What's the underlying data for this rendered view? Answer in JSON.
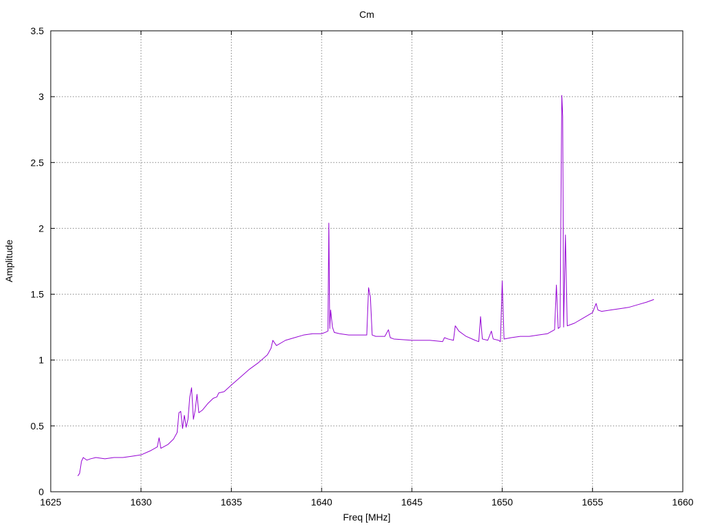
{
  "chart_data": {
    "type": "line",
    "title": "Cm",
    "xlabel": "Freq [MHz]",
    "ylabel": "Amplitude",
    "xlim": [
      1625,
      1660
    ],
    "ylim": [
      0,
      3.5
    ],
    "xticks": [
      1625,
      1630,
      1635,
      1640,
      1645,
      1650,
      1655,
      1660
    ],
    "yticks": [
      0,
      0.5,
      1,
      1.5,
      2,
      2.5,
      3,
      3.5
    ],
    "xtick_labels": [
      "1625",
      "1630",
      "1635",
      "1640",
      "1645",
      "1650",
      "1655",
      "1660"
    ],
    "ytick_labels": [
      "0",
      "0.5",
      "1",
      "1.5",
      "2",
      "2.5",
      "3",
      "3.5"
    ],
    "grid": true,
    "line_color": "#9400d3",
    "series": [
      {
        "x": [
          1626.5,
          1626.6,
          1626.7,
          1626.8,
          1627.0,
          1627.2,
          1627.5,
          1628.0,
          1628.5,
          1629.0,
          1629.5,
          1630.0,
          1630.5,
          1630.9,
          1631.0,
          1631.1,
          1631.5,
          1631.8,
          1632.0,
          1632.1,
          1632.2,
          1632.3,
          1632.4,
          1632.5,
          1632.6,
          1632.7,
          1632.8,
          1632.9,
          1633.0,
          1633.1,
          1633.2,
          1633.4,
          1633.7,
          1634.0,
          1634.2,
          1634.3,
          1634.6,
          1635.0,
          1635.5,
          1636.0,
          1636.5,
          1637.0,
          1637.2,
          1637.3,
          1637.5,
          1638.0,
          1638.5,
          1639.0,
          1639.5,
          1640.0,
          1640.2,
          1640.35,
          1640.4,
          1640.45,
          1640.5,
          1640.6,
          1640.7,
          1641.0,
          1641.5,
          1642.0,
          1642.5,
          1642.6,
          1642.7,
          1642.8,
          1643.0,
          1643.5,
          1643.7,
          1643.8,
          1644.0,
          1645.0,
          1646.0,
          1646.7,
          1646.8,
          1647.0,
          1647.3,
          1647.4,
          1647.6,
          1648.0,
          1648.5,
          1648.7,
          1648.8,
          1648.9,
          1649.2,
          1649.4,
          1649.5,
          1649.8,
          1649.9,
          1650.0,
          1650.1,
          1650.5,
          1651.0,
          1651.5,
          1652.0,
          1652.5,
          1652.9,
          1653.0,
          1653.1,
          1653.2,
          1653.3,
          1653.35,
          1653.4,
          1653.5,
          1653.6,
          1654.0,
          1654.5,
          1655.0,
          1655.2,
          1655.3,
          1655.5,
          1656.0,
          1656.5,
          1657.0,
          1657.5,
          1658.0,
          1658.4
        ],
        "y": [
          0.12,
          0.14,
          0.23,
          0.26,
          0.24,
          0.25,
          0.26,
          0.25,
          0.26,
          0.26,
          0.27,
          0.28,
          0.31,
          0.34,
          0.41,
          0.33,
          0.36,
          0.4,
          0.45,
          0.6,
          0.61,
          0.48,
          0.58,
          0.49,
          0.55,
          0.72,
          0.79,
          0.55,
          0.62,
          0.74,
          0.6,
          0.62,
          0.67,
          0.71,
          0.72,
          0.75,
          0.76,
          0.81,
          0.87,
          0.93,
          0.98,
          1.04,
          1.09,
          1.15,
          1.11,
          1.15,
          1.17,
          1.19,
          1.2,
          1.2,
          1.21,
          1.22,
          2.04,
          1.24,
          1.38,
          1.25,
          1.21,
          1.2,
          1.19,
          1.19,
          1.19,
          1.55,
          1.48,
          1.19,
          1.18,
          1.18,
          1.23,
          1.17,
          1.16,
          1.15,
          1.15,
          1.14,
          1.17,
          1.16,
          1.15,
          1.26,
          1.22,
          1.18,
          1.15,
          1.14,
          1.33,
          1.16,
          1.15,
          1.22,
          1.16,
          1.15,
          1.14,
          1.6,
          1.16,
          1.17,
          1.18,
          1.18,
          1.19,
          1.2,
          1.23,
          1.57,
          1.24,
          1.25,
          3.01,
          2.85,
          1.25,
          1.95,
          1.26,
          1.28,
          1.32,
          1.36,
          1.43,
          1.38,
          1.37,
          1.38,
          1.39,
          1.4,
          1.42,
          1.44,
          1.46
        ]
      }
    ]
  }
}
